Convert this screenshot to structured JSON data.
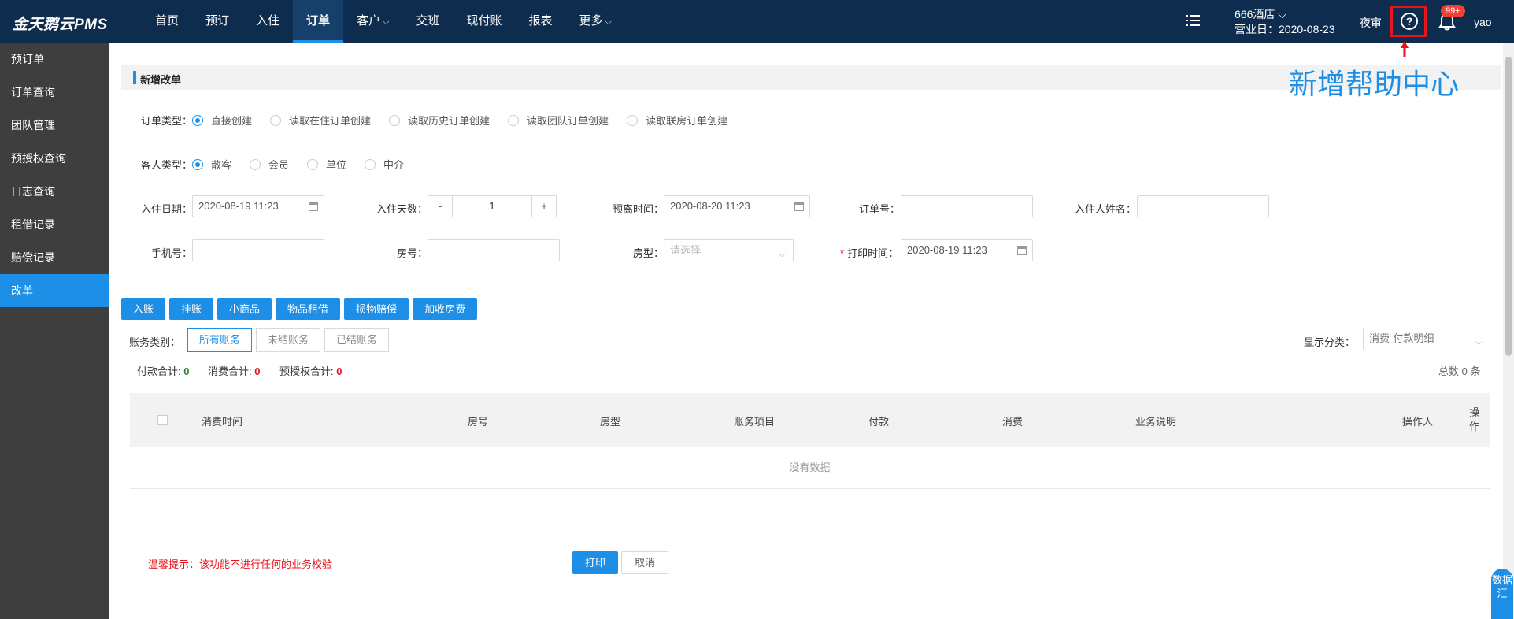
{
  "app": {
    "logo": "金天鹅云PMS"
  },
  "nav": {
    "items": [
      {
        "label": "首页",
        "chev": ""
      },
      {
        "label": "预订",
        "chev": ""
      },
      {
        "label": "入住",
        "chev": ""
      },
      {
        "label": "订单",
        "chev": ""
      },
      {
        "label": "客户",
        "chev": "⌵"
      },
      {
        "label": "交班",
        "chev": ""
      },
      {
        "label": "现付账",
        "chev": ""
      },
      {
        "label": "报表",
        "chev": ""
      },
      {
        "label": "更多",
        "chev": "⌵"
      }
    ],
    "active": "订单"
  },
  "header": {
    "hotel_name": "666酒店 ⌵",
    "business_day": "营业日：2020-08-23",
    "night_audit": "夜审",
    "help_icon_text": "?",
    "badge": "99+",
    "user": "yao"
  },
  "annotation": {
    "text": "新增帮助中心",
    "color": "#1e8fe6"
  },
  "sidebar": {
    "items": [
      "预订单",
      "订单查询",
      "团队管理",
      "预授权查询",
      "日志查询",
      "租借记录",
      "赔偿记录",
      "改单"
    ],
    "active": "改单"
  },
  "section": {
    "title": "新增改单"
  },
  "form": {
    "order_type_label": "订单类型：",
    "order_types": [
      "直接创建",
      "读取在住订单创建",
      "读取历史订单创建",
      "读取团队订单创建",
      "读取联房订单创建"
    ],
    "guest_type_label": "客人类型：",
    "guest_types": [
      "散客",
      "会员",
      "单位",
      "中介"
    ],
    "checkin_date_label": "入住日期：",
    "checkin_date": "2020-08-19 11:23",
    "days_label": "入住天数：",
    "days_minus": "-",
    "days_value": "1",
    "days_plus": "+",
    "checkout_label": "预离时间：",
    "checkout_date": "2020-08-20 11:23",
    "order_no_label": "订单号：",
    "guest_name_label": "入住人姓名：",
    "phone_label": "手机号：",
    "room_no_label": "房号：",
    "room_type_label": "房型：",
    "room_type_placeholder": "请选择",
    "print_time_required": "*",
    "print_time_label": "打印时间：",
    "print_time": "2020-08-19 11:23"
  },
  "actions": [
    "入账",
    "挂账",
    "小商品",
    "物品租借",
    "损物赔偿",
    "加收房费"
  ],
  "account": {
    "category_label": "账务类别：",
    "tabs": [
      "所有账务",
      "未结账务",
      "已结账务"
    ],
    "display_label": "显示分类：",
    "display_value": "消费-付款明细",
    "pay_total_label": "付款合计:",
    "pay_total": "0",
    "consume_total_label": "消费合计:",
    "consume_total": "0",
    "preauth_total_label": "预授权合计:",
    "preauth_total": "0",
    "total_count": "总数 0 条"
  },
  "table": {
    "columns": [
      "消费时间",
      "房号",
      "房型",
      "账务项目",
      "付款",
      "消费",
      "业务说明",
      "操作人",
      "操作"
    ],
    "empty": "没有数据"
  },
  "footer": {
    "tip": "温馨提示：该功能不进行任何的业务校验",
    "print": "打印",
    "cancel": "取消"
  },
  "side_tab": {
    "text": "数据汇"
  }
}
